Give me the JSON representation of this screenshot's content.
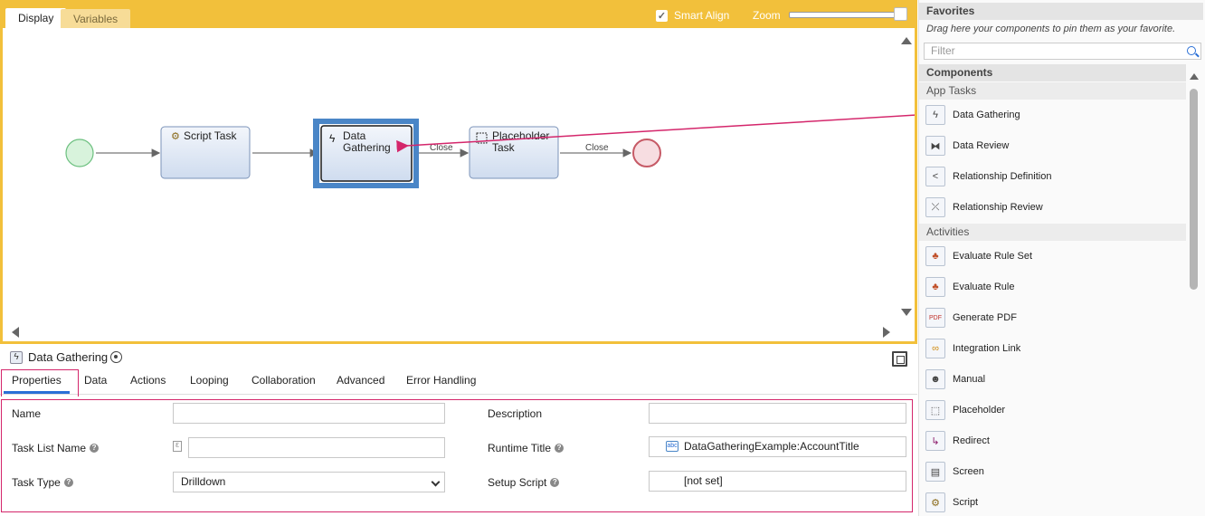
{
  "canvas": {
    "tabs": [
      {
        "label": "Display",
        "active": true
      },
      {
        "label": "Variables",
        "active": false
      }
    ],
    "smart_align": {
      "label": "Smart Align",
      "checked": true
    },
    "zoom": {
      "label": "Zoom",
      "level": 1.0
    },
    "nodes": {
      "script_task": "Script Task",
      "data_gathering_line1": "Data",
      "data_gathering_line2": "Gathering",
      "placeholder_line1": "Placeholder",
      "placeholder_line2": "Task"
    },
    "edge_labels": {
      "close_1": "Close",
      "close_2": "Close"
    }
  },
  "selection": {
    "title": "Data Gathering"
  },
  "property_tabs": [
    "Properties",
    "Data",
    "Actions",
    "Looping",
    "Collaboration",
    "Advanced",
    "Error Handling"
  ],
  "form": {
    "name": {
      "label": "Name",
      "value": ""
    },
    "task_list_name": {
      "label": "Task List Name",
      "value": ""
    },
    "task_type": {
      "label": "Task Type",
      "value": "Drilldown"
    },
    "description": {
      "label": "Description",
      "value": ""
    },
    "runtime_title": {
      "label": "Runtime Title",
      "value": "DataGatheringExample:AccountTitle"
    },
    "setup_script": {
      "label": "Setup Script",
      "value": "[not set]"
    }
  },
  "right_panel": {
    "favorites": {
      "title": "Favorites",
      "hint": "Drag here your components to pin them as your favorite.",
      "filter_placeholder": "Filter"
    },
    "components_title": "Components",
    "app_tasks": {
      "title": "App Tasks",
      "items": [
        "Data Gathering",
        "Data Review",
        "Relationship Definition",
        "Relationship Review"
      ]
    },
    "activities": {
      "title": "Activities",
      "items": [
        "Evaluate Rule Set",
        "Evaluate Rule",
        "Generate PDF",
        "Integration Link",
        "Manual",
        "Placeholder",
        "Redirect",
        "Screen",
        "Script"
      ]
    }
  },
  "colors": {
    "canvas_accent": "#f2c03b",
    "highlight": "#d4266b",
    "selection_blue": "#4a86c7",
    "tab_underline": "#2a6fd6"
  }
}
